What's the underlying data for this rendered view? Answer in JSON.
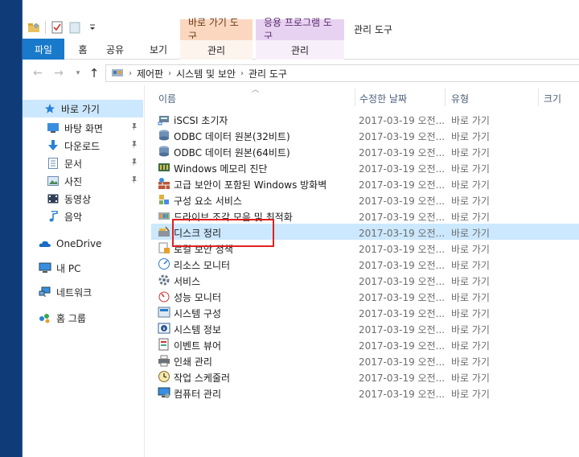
{
  "title_bar": {
    "context_tab_shortcut": "바로 가기 도구",
    "context_tab_app": "응용 프로그램 도구",
    "context_title": "관리 도구"
  },
  "ribbon": {
    "file": "파일",
    "home": "홈",
    "share": "공유",
    "view": "보기",
    "manage_shortcut": "관리",
    "manage_app": "관리"
  },
  "address": {
    "crumbs": [
      "제어판",
      "시스템 및 보안",
      "관리 도구"
    ]
  },
  "nav": {
    "quick_access": "바로 가기",
    "items": [
      {
        "label": "바탕 화면",
        "icon": "desktop-icon",
        "pinned": true
      },
      {
        "label": "다운로드",
        "icon": "download-icon",
        "pinned": true
      },
      {
        "label": "문서",
        "icon": "document-icon",
        "pinned": true
      },
      {
        "label": "사진",
        "icon": "pictures-icon",
        "pinned": true
      },
      {
        "label": "동영상",
        "icon": "videos-icon",
        "pinned": false
      },
      {
        "label": "음악",
        "icon": "music-icon",
        "pinned": false
      }
    ],
    "onedrive": "OneDrive",
    "this_pc": "내 PC",
    "network": "네트워크",
    "homegroup": "홈 그룹"
  },
  "columns": {
    "name": "이름",
    "date": "수정한 날짜",
    "type": "유형",
    "size": "크기"
  },
  "files": [
    {
      "name": "iSCSI 초기자",
      "date": "2017-03-19 오전...",
      "type": "바로 가기"
    },
    {
      "name": "ODBC 데이터 원본(32비트)",
      "date": "2017-03-19 오전...",
      "type": "바로 가기"
    },
    {
      "name": "ODBC 데이터 원본(64비트)",
      "date": "2017-03-19 오전...",
      "type": "바로 가기"
    },
    {
      "name": "Windows 메모리 진단",
      "date": "2017-03-19 오전...",
      "type": "바로 가기"
    },
    {
      "name": "고급 보안이 포함된 Windows 방화벽",
      "date": "2017-03-19 오전...",
      "type": "바로 가기"
    },
    {
      "name": "구성 요소 서비스",
      "date": "2017-03-19 오전...",
      "type": "바로 가기"
    },
    {
      "name": "드라이브 조각 모음 및 최적화",
      "date": "2017-03-19 오전...",
      "type": "바로 가기"
    },
    {
      "name": "디스크 정리",
      "date": "2017-03-19 오전...",
      "type": "바로 가기",
      "selected": true
    },
    {
      "name": "로컬 보안 정책",
      "date": "2017-03-19 오전...",
      "type": "바로 가기"
    },
    {
      "name": "리소스 모니터",
      "date": "2017-03-19 오전...",
      "type": "바로 가기"
    },
    {
      "name": "서비스",
      "date": "2017-03-19 오전...",
      "type": "바로 가기"
    },
    {
      "name": "성능 모니터",
      "date": "2017-03-19 오전...",
      "type": "바로 가기"
    },
    {
      "name": "시스템 구성",
      "date": "2017-03-19 오전...",
      "type": "바로 가기"
    },
    {
      "name": "시스템 정보",
      "date": "2017-03-19 오전...",
      "type": "바로 가기"
    },
    {
      "name": "이벤트 뷰어",
      "date": "2017-03-19 오전...",
      "type": "바로 가기"
    },
    {
      "name": "인쇄 관리",
      "date": "2017-03-19 오전...",
      "type": "바로 가기"
    },
    {
      "name": "작업 스케줄러",
      "date": "2017-03-19 오전...",
      "type": "바로 가기"
    },
    {
      "name": "컴퓨터 관리",
      "date": "2017-03-19 오전...",
      "type": "바로 가기"
    }
  ],
  "colors": {
    "file_tab": "#1979ca",
    "selection": "#cce8ff",
    "highlight": "#e02020",
    "shortcut_tools": "#fbd7c0",
    "app_tools": "#e8d2f2"
  }
}
